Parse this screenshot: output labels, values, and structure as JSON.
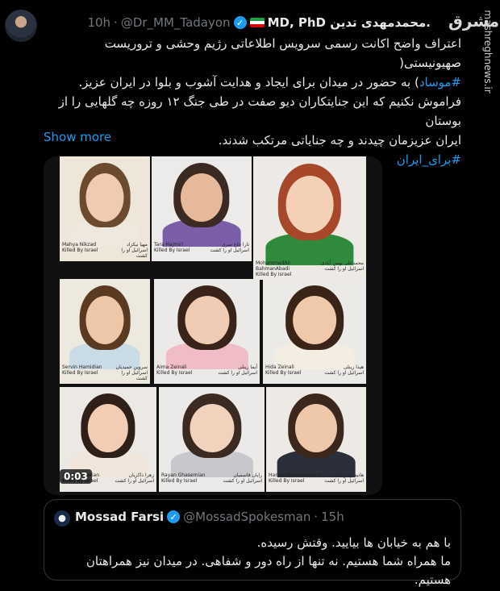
{
  "tweet": {
    "author_name": "MD, PhD محمدمهدی تدین.",
    "handle": "@Dr_MM_Tadayon",
    "time": "10h",
    "separator": "·",
    "verified_mark": "✓",
    "body_lines": [
      "اعتراف واضح اکانت رسمی سرویس اطلاعاتی رژیم وحشی و تروریست صهیونیستی(",
      "#موساد) به حضور در میدان برای ایجاد و هدایت آشوب و بلوا در ایران عزیز.",
      "فراموش نکنیم که این جنایتکاران دیو صفت در طی جنگ ۱۲ روزه چه گلهایی را از بوستان",
      "ایران عزیزمان چیدند و چه جنایاتی مرتکب شدند."
    ],
    "hashtag_body": "#موساد",
    "hashtag_footer": "#برای_ایران",
    "show_more": "Show more"
  },
  "brand": {
    "logo_text": "مشرق",
    "watermark": "mashreghnews.ir"
  },
  "media": {
    "duration": "0:03",
    "portraits": [
      {
        "en_name": "Mahya Nikzad",
        "fa_name": "مهیا نیکزاد",
        "killed_en": "Killed By Israel",
        "killed_fa": "اسرائیل او را کشت",
        "bg": "#efe6da",
        "hair": "#6b4a2e",
        "shirt": "#eee8df",
        "skin": "#f0cbb0"
      },
      {
        "en_name": "Tara Hajmiri",
        "fa_name": "تارا حاج میری",
        "killed_en": "Killed By Israel",
        "killed_fa": "اسرائیل او را کشت",
        "bg": "#ecebea",
        "hair": "#3a2a22",
        "shirt": "#7a5fa8",
        "skin": "#e6b99a"
      },
      {
        "en_name": "MohammadAli BahmanAbadi",
        "fa_name": "محمدعلی بهمن آبادی",
        "killed_en": "Killed By Israel",
        "killed_fa": "اسرائیل او را کشت",
        "bg": "#edeae5",
        "hair": "#a8482a",
        "shirt": "#2f8a3c",
        "skin": "#f3d0b6"
      },
      {
        "en_name": "Servin Hamidian",
        "fa_name": "سروین حمیدیان",
        "killed_en": "Killed By Israel",
        "killed_fa": "اسرائیل او را کشت",
        "bg": "#eee9df",
        "hair": "#5b3a22",
        "shirt": "#c9dbe6",
        "skin": "#eec6a8"
      },
      {
        "en_name": "Aima Zeinali",
        "fa_name": "آیما زینلی",
        "killed_en": "Killed By Israel",
        "killed_fa": "اسرائیل او را کشت",
        "bg": "#eceae8",
        "hair": "#3a2419",
        "shirt": "#f0bcc6",
        "skin": "#f1ccb4"
      },
      {
        "en_name": "Hida Zeinali",
        "fa_name": "هیدا زینلی",
        "killed_en": "Killed By Israel",
        "killed_fa": "اسرائیل او را کشت",
        "bg": "#eceae7",
        "hair": "#3a2418",
        "shirt": "#f3ede2",
        "skin": "#f0c8aa"
      },
      {
        "en_name": "Zahra Zakerian",
        "fa_name": "زهرا ذاکریان",
        "killed_en": "Killed By Israel",
        "killed_fa": "اسرائیل او را کشت",
        "bg": "#ece9e5",
        "hair": "#2e2018",
        "shirt": "#f0e6dc",
        "skin": "#f2cdb4"
      },
      {
        "en_name": "Rayan Ghasemian",
        "fa_name": "رایان قاسمیان",
        "killed_en": "Killed By Israel",
        "killed_fa": "اسرائیل او را کشت",
        "bg": "#eceae8",
        "hair": "#3a2a22",
        "shirt": "#c8c8cc",
        "skin": "#f2d2bc"
      },
      {
        "en_name": "Hanieh BahmanAbadi",
        "fa_name": "هانیه بهمن آبادی",
        "killed_en": "Killed By Israel",
        "killed_fa": "اسرائیل او را کشت",
        "bg": "#edeae5",
        "hair": "#3b271b",
        "shirt": "#2a2f3a",
        "skin": "#efc7a9"
      }
    ]
  },
  "quote": {
    "author_name": "Mossad Farsi",
    "handle": "@MossadSpokesman",
    "time": "15h",
    "separator": "·",
    "verified_mark": "✓",
    "lines": [
      "با هم به خیابان ها بیایید. وقتش رسیده.",
      "ما همراه شما هستیم. نه تنها از راه دور و شفاهی. در میدان نیز همراهتان هستیم."
    ]
  }
}
